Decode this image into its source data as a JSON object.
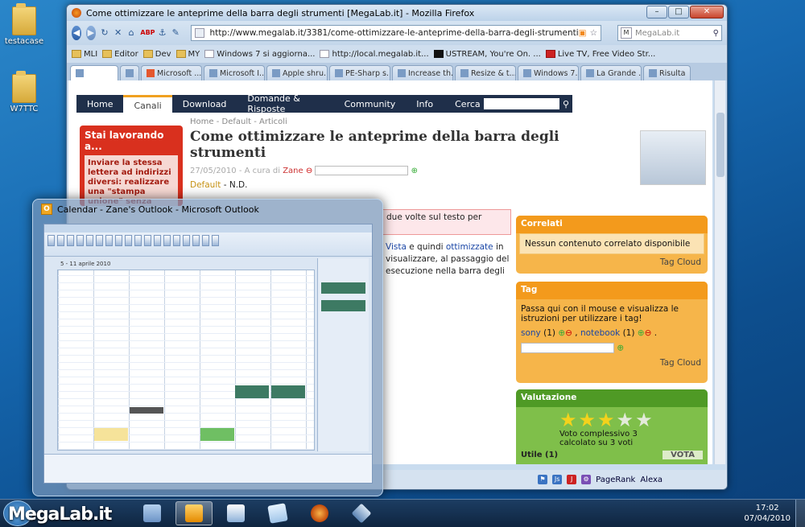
{
  "desktop": {
    "icons": [
      {
        "label": "testacase"
      },
      {
        "label": "W7TTC"
      }
    ]
  },
  "firefox": {
    "title": "Come ottimizzare le anteprime della barra degli strumenti [MegaLab.it] - Mozilla Firefox",
    "url": "http://www.megalab.it/3381/come-ottimizzare-le-anteprime-della-barra-degli-strumenti",
    "search_placeholder": "MegaLab.it",
    "bookmarks": [
      "MLI",
      "Editor",
      "Dev",
      "MY",
      "Windows 7 si aggiorna...",
      "http://local.megalab.it...",
      "USTREAM, You're On. ...",
      "Live TV, Free Video Str..."
    ],
    "tabs": [
      "Microsoft ...",
      "Microsoft I...",
      "Apple shru...",
      "PE-Sharp s...",
      "Increase th...",
      "Resize & t...",
      "Windows 7...",
      "La Grande ...",
      "Risulta"
    ],
    "site_nav": [
      "Home",
      "Canali",
      "Download",
      "Domande & Risposte",
      "Community",
      "Info"
    ],
    "site_search_label": "Cerca",
    "breadcrumb": "Home - Default - Articoli",
    "article_title": "Come ottimizzare le anteprime della barra degli strumenti",
    "article_date": "27/05/2010",
    "article_by": "A cura di",
    "article_author": "Zane",
    "category_key": "Default",
    "category_value": "- N.D.",
    "promo_title": "Stai lavorando a...",
    "promo_text": "Inviare la stessa lettera ad indirizzi diversi: realizzare una \"stampa unione\" senza impazzire Contenuto senza",
    "pink_box_text": "due volte sul testo per",
    "body_line1_link1": "Vista",
    "body_line1_mid": "e quindi",
    "body_line1_link2": "ottimizzate",
    "body_line1_end": "in",
    "body_line2": "visualizzare, al passaggio del",
    "body_line3": "esecuzione nella barra degli",
    "correlati_title": "Correlati",
    "correlati_text": "Nessun contenuto correlato disponibile",
    "tag_cloud": "Tag Cloud",
    "tag_title": "Tag",
    "tag_text": "Passa qui con il mouse e visualizza le istruzioni per utilizzare i tag!",
    "tag1": "sony",
    "tag1_count": "(1)",
    "tag2": "notebook",
    "tag2_count": "(1)",
    "valutazione_title": "Valutazione",
    "rating_filled": 3,
    "rating_max": 5,
    "rating_text": "Voto complessivo 3 calcolato su 3 voti",
    "utile_label": "Utile (1)",
    "vota_label": "VOTA",
    "status_items": [
      "PageRank",
      "Alexa"
    ]
  },
  "outlook_preview": {
    "title": "Calendar - Zane's Outlook - Microsoft Outlook",
    "date_range": "5 - 11 aprile 2010"
  },
  "taskbar": {
    "clock_time": "17:02",
    "clock_date": "07/04/2010",
    "logo_text": "MegaLab.it"
  },
  "colors": {
    "site_nav_bg": "#1f2f4a",
    "accent_orange": "#f39a1c",
    "accent_green": "#4f9a25",
    "promo_red": "#d9301e"
  }
}
